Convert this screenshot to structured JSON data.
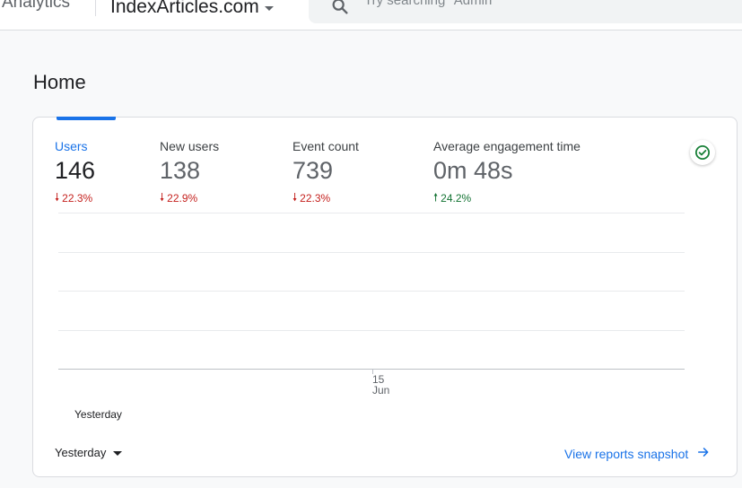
{
  "header": {
    "product_name": "Analytics",
    "property_name": "IndexArticles.com",
    "search_placeholder": "Try searching \"Admin\""
  },
  "page": {
    "title": "Home"
  },
  "metrics": [
    {
      "label": "Users",
      "value": "146",
      "change": "22.3%",
      "direction": "down",
      "active": true
    },
    {
      "label": "New users",
      "value": "138",
      "change": "22.9%",
      "direction": "down",
      "active": false
    },
    {
      "label": "Event count",
      "value": "739",
      "change": "22.3%",
      "direction": "down",
      "active": false
    },
    {
      "label": "Average engagement time",
      "value": "0m 48s",
      "change": "24.2%",
      "direction": "up",
      "active": false
    }
  ],
  "chart": {
    "x_tick_day": "15",
    "x_tick_month": "Jun",
    "legend_label": "Yesterday"
  },
  "footer": {
    "date_range": "Yesterday",
    "link_label": "View reports snapshot"
  },
  "colors": {
    "accent": "#1a73e8",
    "negative": "#c5221f",
    "positive": "#137333",
    "check": "#188038"
  },
  "icons": {
    "search": "search-icon",
    "status": "check-circle-icon",
    "down": "arrow-down-icon",
    "up": "arrow-up-icon",
    "link": "arrow-right-icon"
  }
}
